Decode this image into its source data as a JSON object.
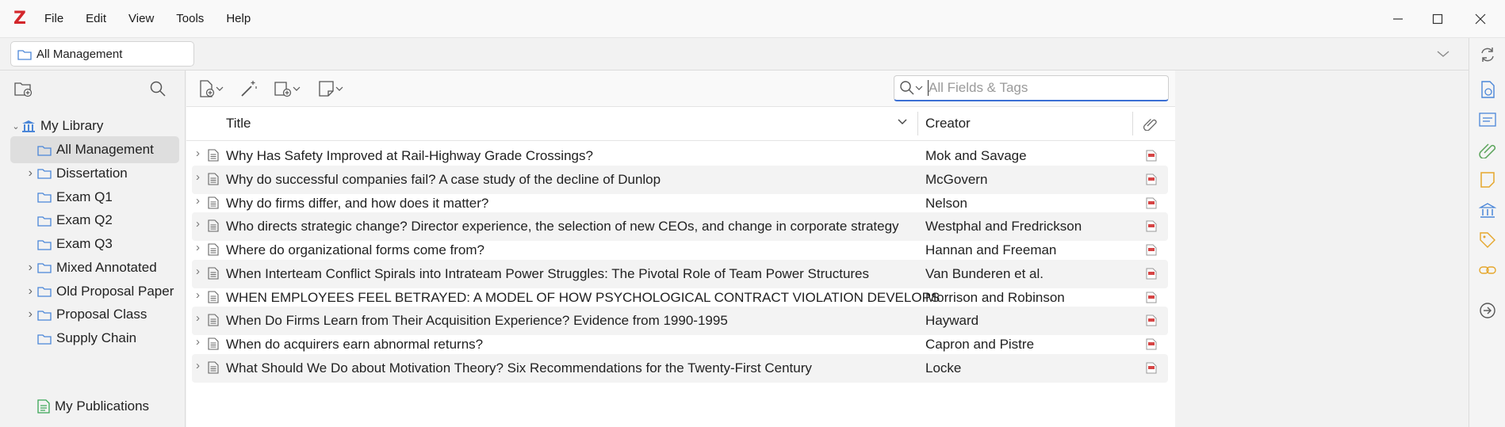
{
  "app": {
    "logo": "Z"
  },
  "menu": [
    "File",
    "Edit",
    "View",
    "Tools",
    "Help"
  ],
  "tab": {
    "label": "All Management"
  },
  "collections": {
    "library_label": "My Library",
    "items": [
      {
        "label": "All Management",
        "selected": true,
        "expandable": false
      },
      {
        "label": "Dissertation",
        "selected": false,
        "expandable": true
      },
      {
        "label": "Exam Q1",
        "selected": false,
        "expandable": false
      },
      {
        "label": "Exam Q2",
        "selected": false,
        "expandable": false
      },
      {
        "label": "Exam Q3",
        "selected": false,
        "expandable": false
      },
      {
        "label": "Mixed Annotated",
        "selected": false,
        "expandable": true
      },
      {
        "label": "Old Proposal Paper",
        "selected": false,
        "expandable": true
      },
      {
        "label": "Proposal Class",
        "selected": false,
        "expandable": true
      },
      {
        "label": "Supply Chain",
        "selected": false,
        "expandable": false
      }
    ],
    "publications_label": "My Publications"
  },
  "search": {
    "placeholder": "All Fields & Tags",
    "value": ""
  },
  "columns": {
    "title": "Title",
    "creator": "Creator"
  },
  "rows": [
    {
      "title": "Why Has Safety Improved at Rail-Highway Grade Crossings?",
      "creator": "Mok and Savage"
    },
    {
      "title": "Why do successful companies fail? A case study of the decline of Dunlop",
      "creator": "McGovern"
    },
    {
      "title": "Why do firms differ, and how does it matter?",
      "creator": "Nelson"
    },
    {
      "title": "Who directs strategic change? Director experience, the selection of new CEOs, and change in corporate strategy",
      "creator": "Westphal and Fredrickson"
    },
    {
      "title": "Where do organizational forms come from?",
      "creator": "Hannan and Freeman"
    },
    {
      "title": "When Interteam Conflict Spirals into Intrateam Power Struggles: The Pivotal Role of Team Power Structures",
      "creator": "Van Bunderen et al."
    },
    {
      "title": "WHEN EMPLOYEES FEEL BETRAYED: A MODEL OF HOW PSYCHOLOGICAL CONTRACT VIOLATION DEVELOPS",
      "creator": "Morrison and Robinson"
    },
    {
      "title": "When Do Firms Learn from Their Acquisition Experience? Evidence from 1990-1995",
      "creator": "Hayward"
    },
    {
      "title": "When do acquirers earn abnormal returns?",
      "creator": "Capron and Pistre"
    },
    {
      "title": "What Should We Do about Motivation Theory? Six Recommendations for the Twenty-First Century",
      "creator": "Locke"
    }
  ],
  "colors": {
    "accent": "#3b6fd4",
    "logo": "#d3262b",
    "folder": "#4a86d8",
    "pdf": "#d64545",
    "publications": "#3aa655"
  }
}
